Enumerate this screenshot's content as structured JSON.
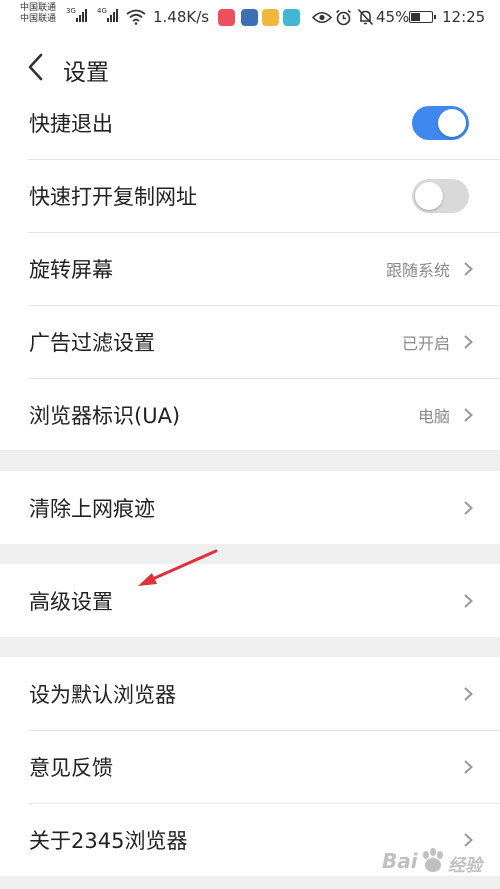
{
  "status_bar": {
    "carrier_1": "中国联通",
    "carrier_2": "中国联通",
    "network_1": "3G",
    "network_2": "4G",
    "speed": "1.48K/s",
    "battery": "45%",
    "battery_level": 0.45,
    "time": "12:25",
    "icons": [
      "signal-icon",
      "signal-icon",
      "wifi-icon",
      "app-icon",
      "app-icon",
      "app-icon",
      "app-icon",
      "eye-icon",
      "alarm-icon",
      "mute-icon",
      "battery-icon"
    ]
  },
  "header": {
    "title": "设置",
    "back_icon": "chevron-left-icon"
  },
  "sections": [
    {
      "rows": [
        {
          "label": "快捷退出",
          "toggle": true
        },
        {
          "label": "快速打开复制网址",
          "toggle": false
        },
        {
          "label": "旋转屏幕",
          "value": "跟随系统"
        },
        {
          "label": "广告过滤设置",
          "value": "已开启"
        },
        {
          "label": "浏览器标识(UA)",
          "value": "电脑"
        }
      ]
    },
    {
      "rows": [
        {
          "label": "清除上网痕迹"
        }
      ]
    },
    {
      "rows": [
        {
          "label": "高级设置"
        }
      ]
    },
    {
      "rows": [
        {
          "label": "设为默认浏览器"
        },
        {
          "label": "意见反馈"
        },
        {
          "label": "关于2345浏览器"
        }
      ]
    }
  ],
  "watermark": {
    "text_1": "Bai",
    "text_2": "经验"
  },
  "colors": {
    "toggle_on": "#3e88f0",
    "toggle_off": "#d9d9d9",
    "annotation_arrow": "#e0303a",
    "background": "#efefef"
  }
}
